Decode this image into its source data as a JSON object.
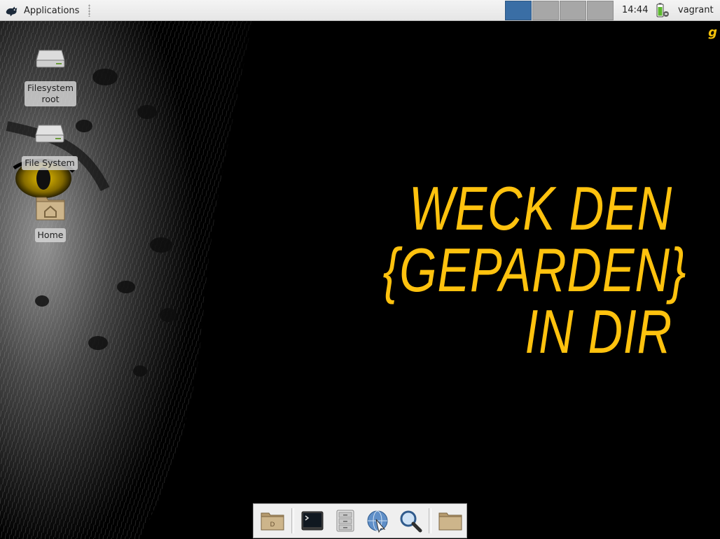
{
  "top_panel": {
    "applications_label": "Applications",
    "workspaces": [
      {
        "name": "workspace-1",
        "active": true
      },
      {
        "name": "workspace-2",
        "active": false
      },
      {
        "name": "workspace-3",
        "active": false
      },
      {
        "name": "workspace-4",
        "active": false
      }
    ],
    "clock": "14:44",
    "user": "vagrant"
  },
  "desktop": {
    "icons": [
      {
        "label": "Filesystem root",
        "icon": "drive-icon"
      },
      {
        "label": "File System",
        "icon": "drive-icon"
      },
      {
        "label": "Home",
        "icon": "home-folder-icon"
      }
    ],
    "wallpaper": {
      "slogan_lines": [
        "WECK DEN",
        "{GEPARDEN}",
        "IN DIR"
      ],
      "corner_mark": "g",
      "accent_color": "#ffc20e"
    }
  },
  "dock": {
    "items": [
      "home-folder-icon",
      "terminal-icon",
      "file-manager-icon",
      "web-browser-icon",
      "search-icon",
      "folder-icon"
    ]
  }
}
